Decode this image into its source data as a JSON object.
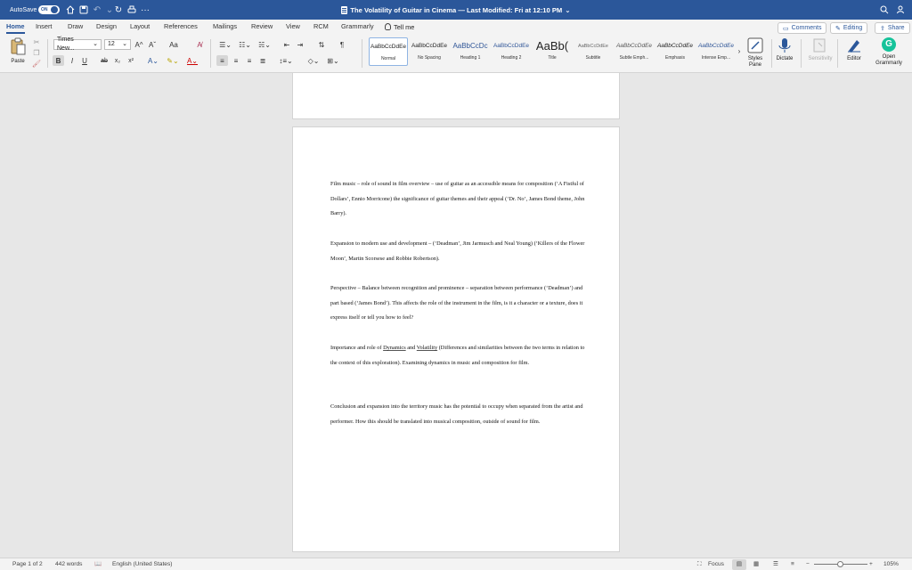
{
  "titlebar": {
    "autosave_label": "AutoSave",
    "autosave_state": "ON",
    "document_title": "The Volatility of Guitar in Cinema — Last Modified: Fri at 12:10 PM",
    "icons": [
      "home-icon",
      "save-icon",
      "undo-icon",
      "redo-icon",
      "refresh-icon",
      "print-icon",
      "more-icon",
      "search-icon",
      "share-person-icon"
    ]
  },
  "tabs": [
    {
      "label": "Home",
      "active": true
    },
    {
      "label": "Insert"
    },
    {
      "label": "Draw"
    },
    {
      "label": "Design"
    },
    {
      "label": "Layout"
    },
    {
      "label": "References"
    },
    {
      "label": "Mailings"
    },
    {
      "label": "Review"
    },
    {
      "label": "View"
    },
    {
      "label": "RCM"
    },
    {
      "label": "Grammarly"
    }
  ],
  "tell_me": "Tell me",
  "right_buttons": {
    "comments": "Comments",
    "editing": "Editing",
    "share": "Share"
  },
  "ribbon": {
    "paste_label": "Paste",
    "font_name": "Times New...",
    "font_size": "12",
    "bold": "B",
    "italic": "I",
    "underline": "U",
    "strike": "ab",
    "subscript": "x₂",
    "superscript": "x²",
    "grow_font": "A^",
    "shrink_font": "Aˇ",
    "change_case": "Aa",
    "pilcrow": "¶",
    "styles": [
      {
        "sample": "AaBbCcDdEe",
        "name": "Normal",
        "selected": true
      },
      {
        "sample": "AaBbCcDdEe",
        "name": "No Spacing"
      },
      {
        "sample": "AaBbCcDc",
        "name": "Heading 1"
      },
      {
        "sample": "AaBbCcDdEe",
        "name": "Heading 2"
      },
      {
        "sample": "AaBb(",
        "name": "Title"
      },
      {
        "sample": "AaBbCcDdEe",
        "name": "Subtitle"
      },
      {
        "sample": "AaBbCcDdEe",
        "name": "Subtle Emph..."
      },
      {
        "sample": "AaBbCcDdEe",
        "name": "Emphasis"
      },
      {
        "sample": "AaBbCcDdEe",
        "name": "Intense Emp..."
      }
    ],
    "styles_pane": "Styles Pane",
    "dictate": "Dictate",
    "sensitivity": "Sensitivity",
    "editor": "Editor",
    "open_grammarly": "Open Grammarly"
  },
  "document": {
    "paragraphs": [
      "Film music – role of sound in film overview – use of guitar as an accessible means for composition (‘A Fistful of Dollars’, Ennio Morricone) the significance of guitar themes and their appeal (‘Dr. No’, James Bond theme, John Barry).",
      "Expansion to modern use and development – (‘Deadman’, Jim Jarmusch and Neal Young) (‘Killers of the Flower Moon’, Martin Scorsese and Robbie Robertson).",
      "Perspective – Balance between recognition and prominence – separation between performance (‘Deadman’) and part based (‘James Bond’). This affects the role of the instrument in the film, is it a character or a texture, does it express itself or tell you how to feel?",
      {
        "before": "Importance and role of ",
        "u1": "Dynamics",
        "mid": " and ",
        "u2": "Volatility",
        "after": " (Differences and similarities between the two terms in relation to the context of this exploration). Examining dynamics in music and composition for film."
      },
      "Conclusion and expansion into the territory music has the potential to occupy when separated from the artist and performer. How this should be translated into musical composition, outside of sound for film."
    ]
  },
  "status": {
    "page": "Page 1 of 2",
    "words": "442 words",
    "language": "English (United States)",
    "focus": "Focus",
    "zoom": "105%",
    "zoom_minus": "−",
    "zoom_plus": "+"
  },
  "colors": {
    "brand": "#2b579a",
    "grammarly": "#15c39a"
  }
}
